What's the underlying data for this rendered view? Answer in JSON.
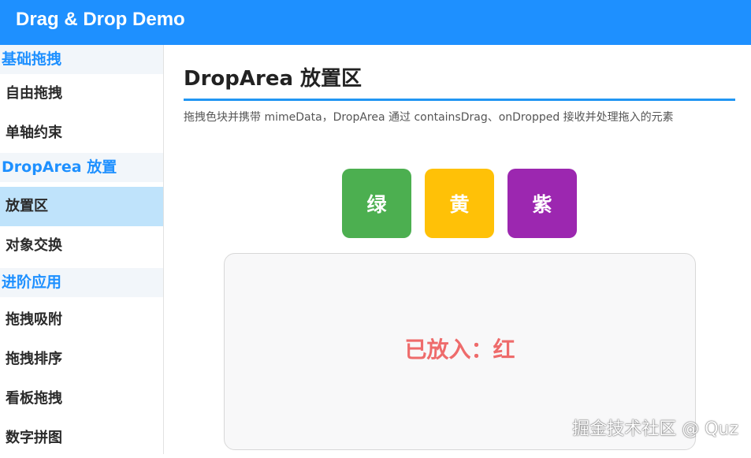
{
  "header": {
    "title": "Drag & Drop Demo"
  },
  "sidebar": {
    "sections": [
      {
        "label": "基础拖拽",
        "items": [
          "自由拖拽",
          "单轴约束"
        ]
      },
      {
        "label": "DropArea 放置",
        "items": [
          "放置区",
          "对象交换"
        ]
      },
      {
        "label": "进阶应用",
        "items": [
          "拖拽吸附",
          "拖拽排序",
          "看板拖拽",
          "数字拼图"
        ]
      }
    ],
    "active_item": "放置区"
  },
  "main": {
    "title": "DropArea 放置区",
    "description": "拖拽色块并携带 mimeData，DropArea 通过 containsDrag、onDropped 接收并处理拖入的元素",
    "blocks": [
      {
        "label": "绿",
        "color": "#4caf50"
      },
      {
        "label": "黄",
        "color": "#ffc107"
      },
      {
        "label": "紫",
        "color": "#9c27b0"
      }
    ],
    "drop_area": {
      "text": "已放入：红",
      "text_color": "#ee6b6b"
    }
  },
  "watermark": "掘金技术社区 @ Quz",
  "colors": {
    "accent": "#1e90ff",
    "active_bg": "#bfe3fb",
    "section_bg": "#f2f6fa"
  }
}
